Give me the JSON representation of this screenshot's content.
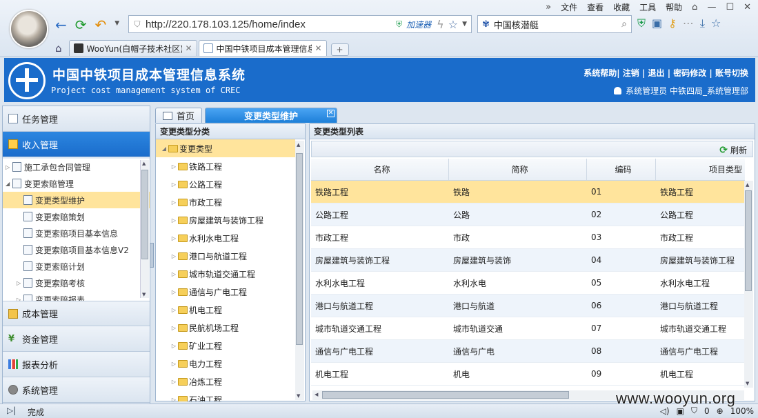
{
  "browser": {
    "menu": [
      "文件",
      "查看",
      "收藏",
      "工具",
      "帮助"
    ],
    "url": "http://220.178.103.125/home/index",
    "accelerator_label": "加速器",
    "search_query": "中国核潜艇",
    "tabs": [
      {
        "title": "WooYun(白帽子技术社区)"
      },
      {
        "title": "中国中铁项目成本管理信息系统"
      }
    ]
  },
  "app": {
    "title": "中国中铁项目成本管理信息系统",
    "subtitle": "Project cost management system of CREC",
    "header_links": "系统帮助| 注销 | 退出 | 密码修改 | 账号切换",
    "user": "系统管理员 中铁四局_系统管理部"
  },
  "leftnav": {
    "top_sections": [
      {
        "label": "任务管理"
      },
      {
        "label": "收入管理"
      }
    ],
    "tree": [
      {
        "label": "施工承包合同管理",
        "level": 0,
        "arrow": "▷"
      },
      {
        "label": "变更索赔管理",
        "level": 0,
        "arrow": "◢"
      },
      {
        "label": "变更类型维护",
        "level": 1,
        "arrow": ""
      },
      {
        "label": "变更索赔策划",
        "level": 1,
        "arrow": ""
      },
      {
        "label": "变更索赔项目基本信息",
        "level": 1,
        "arrow": ""
      },
      {
        "label": "变更索赔项目基本信息V2",
        "level": 1,
        "arrow": ""
      },
      {
        "label": "变更索赔计划",
        "level": 1,
        "arrow": ""
      },
      {
        "label": "变更索赔考核",
        "level": 1,
        "arrow": "▷"
      },
      {
        "label": "变更索赔报表",
        "level": 1,
        "arrow": "▷"
      }
    ],
    "bottom_sections": [
      {
        "label": "成本管理"
      },
      {
        "label": "资金管理"
      },
      {
        "label": "报表分析"
      },
      {
        "label": "系统管理"
      }
    ]
  },
  "content_tabs": {
    "home": "首页",
    "active": "变更类型维护"
  },
  "category_panel": {
    "title": "变更类型分类",
    "root": "变更类型",
    "children": [
      "铁路工程",
      "公路工程",
      "市政工程",
      "房屋建筑与装饰工程",
      "水利水电工程",
      "港口与航道工程",
      "城市轨道交通工程",
      "通信与广电工程",
      "机电工程",
      "民航机场工程",
      "矿业工程",
      "电力工程",
      "冶炼工程",
      "石油工程"
    ]
  },
  "list_panel": {
    "title": "变更类型列表",
    "refresh_label": "刷新",
    "columns": [
      "名称",
      "简称",
      "编码",
      "项目类型"
    ],
    "rows": [
      [
        "铁路工程",
        "铁路",
        "01",
        "铁路工程"
      ],
      [
        "公路工程",
        "公路",
        "02",
        "公路工程"
      ],
      [
        "市政工程",
        "市政",
        "03",
        "市政工程"
      ],
      [
        "房屋建筑与装饰工程",
        "房屋建筑与装饰",
        "04",
        "房屋建筑与装饰工程"
      ],
      [
        "水利水电工程",
        "水利水电",
        "05",
        "水利水电工程"
      ],
      [
        "港口与航道工程",
        "港口与航道",
        "06",
        "港口与航道工程"
      ],
      [
        "城市轨道交通工程",
        "城市轨道交通",
        "07",
        "城市轨道交通工程"
      ],
      [
        "通信与广电工程",
        "通信与广电",
        "08",
        "通信与广电工程"
      ],
      [
        "机电工程",
        "机电",
        "09",
        "机电工程"
      ]
    ]
  },
  "statusbar": {
    "status": "完成",
    "count": "0",
    "zoom": "100%"
  },
  "watermark": "www.wooyun.org"
}
